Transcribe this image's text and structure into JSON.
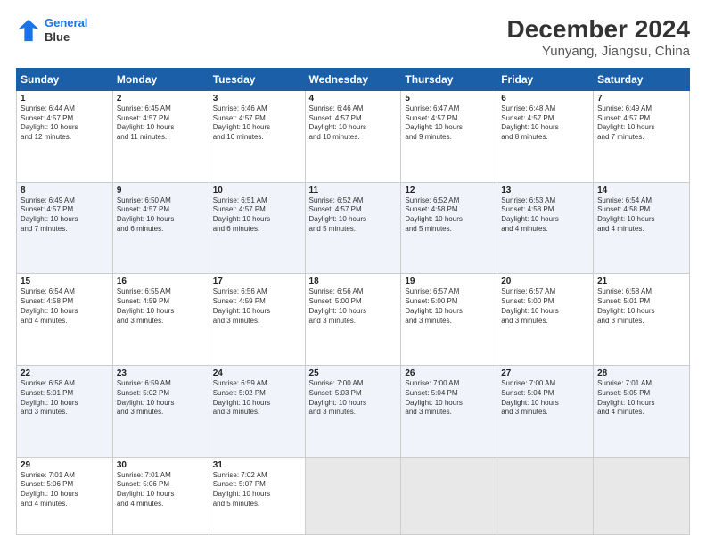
{
  "header": {
    "logo": {
      "line1": "General",
      "line2": "Blue"
    },
    "title": "December 2024",
    "subtitle": "Yunyang, Jiangsu, China"
  },
  "calendar": {
    "days": [
      "Sunday",
      "Monday",
      "Tuesday",
      "Wednesday",
      "Thursday",
      "Friday",
      "Saturday"
    ],
    "weeks": [
      [
        null,
        {
          "num": "2",
          "rise": "6:45 AM",
          "set": "4:57 PM",
          "daylight": "10 hours and 11 minutes."
        },
        {
          "num": "3",
          "rise": "6:46 AM",
          "set": "4:57 PM",
          "daylight": "10 hours and 10 minutes."
        },
        {
          "num": "4",
          "rise": "6:46 AM",
          "set": "4:57 PM",
          "daylight": "10 hours and 10 minutes."
        },
        {
          "num": "5",
          "rise": "6:47 AM",
          "set": "4:57 PM",
          "daylight": "10 hours and 9 minutes."
        },
        {
          "num": "6",
          "rise": "6:48 AM",
          "set": "4:57 PM",
          "daylight": "10 hours and 8 minutes."
        },
        {
          "num": "7",
          "rise": "6:49 AM",
          "set": "4:57 PM",
          "daylight": "10 hours and 7 minutes."
        }
      ],
      [
        {
          "num": "1",
          "rise": "6:44 AM",
          "set": "4:57 PM",
          "daylight": "10 hours and 12 minutes."
        },
        {
          "num": "9",
          "rise": "6:50 AM",
          "set": "4:57 PM",
          "daylight": "10 hours and 6 minutes."
        },
        {
          "num": "10",
          "rise": "6:51 AM",
          "set": "4:57 PM",
          "daylight": "10 hours and 6 minutes."
        },
        {
          "num": "11",
          "rise": "6:52 AM",
          "set": "4:57 PM",
          "daylight": "10 hours and 5 minutes."
        },
        {
          "num": "12",
          "rise": "6:52 AM",
          "set": "4:58 PM",
          "daylight": "10 hours and 5 minutes."
        },
        {
          "num": "13",
          "rise": "6:53 AM",
          "set": "4:58 PM",
          "daylight": "10 hours and 4 minutes."
        },
        {
          "num": "14",
          "rise": "6:54 AM",
          "set": "4:58 PM",
          "daylight": "10 hours and 4 minutes."
        }
      ],
      [
        {
          "num": "8",
          "rise": "6:49 AM",
          "set": "4:57 PM",
          "daylight": "10 hours and 7 minutes."
        },
        {
          "num": "16",
          "rise": "6:55 AM",
          "set": "4:59 PM",
          "daylight": "10 hours and 3 minutes."
        },
        {
          "num": "17",
          "rise": "6:56 AM",
          "set": "4:59 PM",
          "daylight": "10 hours and 3 minutes."
        },
        {
          "num": "18",
          "rise": "6:56 AM",
          "set": "5:00 PM",
          "daylight": "10 hours and 3 minutes."
        },
        {
          "num": "19",
          "rise": "6:57 AM",
          "set": "5:00 PM",
          "daylight": "10 hours and 3 minutes."
        },
        {
          "num": "20",
          "rise": "6:57 AM",
          "set": "5:00 PM",
          "daylight": "10 hours and 3 minutes."
        },
        {
          "num": "21",
          "rise": "6:58 AM",
          "set": "5:01 PM",
          "daylight": "10 hours and 3 minutes."
        }
      ],
      [
        {
          "num": "15",
          "rise": "6:54 AM",
          "set": "4:58 PM",
          "daylight": "10 hours and 4 minutes."
        },
        {
          "num": "23",
          "rise": "6:59 AM",
          "set": "5:02 PM",
          "daylight": "10 hours and 3 minutes."
        },
        {
          "num": "24",
          "rise": "6:59 AM",
          "set": "5:02 PM",
          "daylight": "10 hours and 3 minutes."
        },
        {
          "num": "25",
          "rise": "7:00 AM",
          "set": "5:03 PM",
          "daylight": "10 hours and 3 minutes."
        },
        {
          "num": "26",
          "rise": "7:00 AM",
          "set": "5:04 PM",
          "daylight": "10 hours and 3 minutes."
        },
        {
          "num": "27",
          "rise": "7:00 AM",
          "set": "5:04 PM",
          "daylight": "10 hours and 3 minutes."
        },
        {
          "num": "28",
          "rise": "7:01 AM",
          "set": "5:05 PM",
          "daylight": "10 hours and 4 minutes."
        }
      ],
      [
        {
          "num": "22",
          "rise": "6:58 AM",
          "set": "5:01 PM",
          "daylight": "10 hours and 3 minutes."
        },
        {
          "num": "30",
          "rise": "7:01 AM",
          "set": "5:06 PM",
          "daylight": "10 hours and 4 minutes."
        },
        {
          "num": "31",
          "rise": "7:02 AM",
          "set": "5:07 PM",
          "daylight": "10 hours and 5 minutes."
        },
        null,
        null,
        null,
        null
      ],
      [
        {
          "num": "29",
          "rise": "7:01 AM",
          "set": "5:06 PM",
          "daylight": "10 hours and 4 minutes."
        },
        null,
        null,
        null,
        null,
        null,
        null
      ]
    ]
  }
}
